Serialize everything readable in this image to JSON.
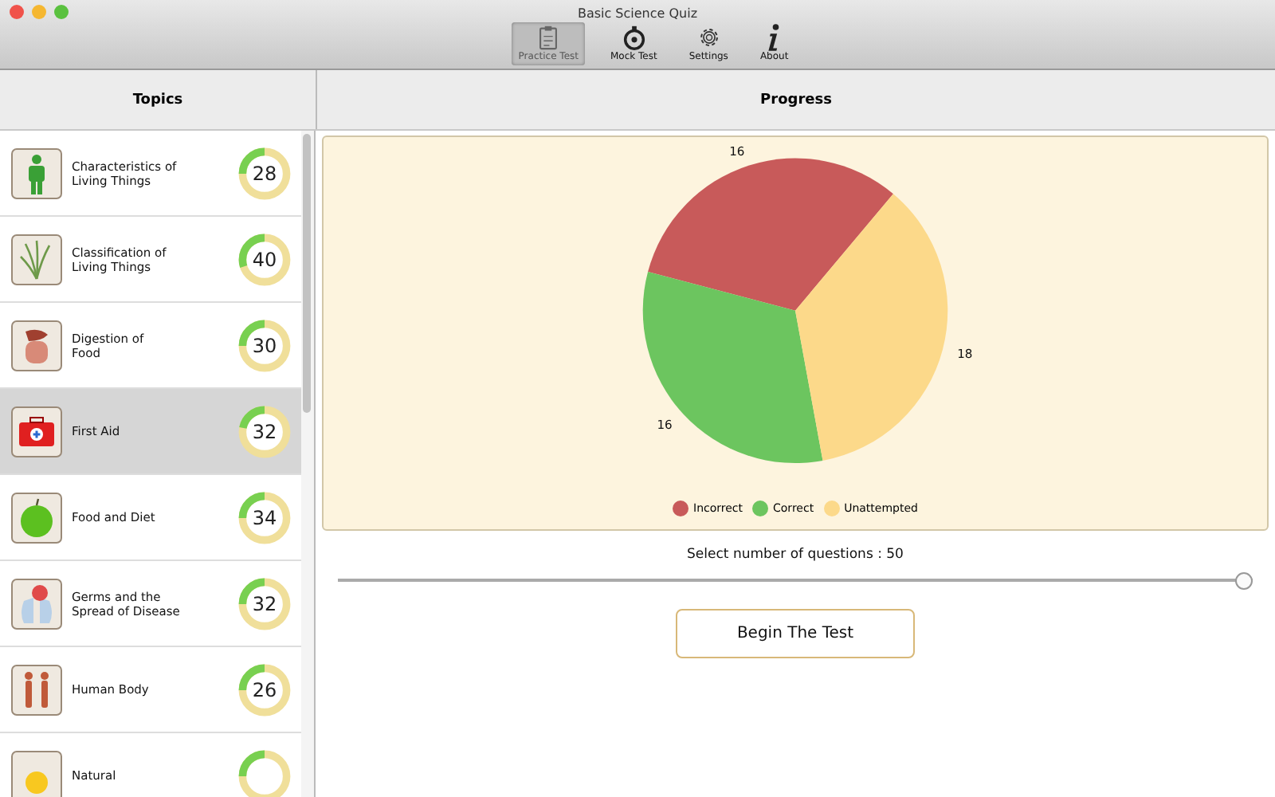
{
  "window": {
    "title": "Basic Science Quiz"
  },
  "toolbar": [
    {
      "label": "Practice Test",
      "kind": "clipboard",
      "selected": true
    },
    {
      "label": "Mock Test",
      "kind": "stopwatch",
      "selected": false
    },
    {
      "label": "Settings",
      "kind": "gear",
      "selected": false
    },
    {
      "label": "About",
      "kind": "info",
      "selected": false
    }
  ],
  "sidebar": {
    "header": "Topics",
    "items": [
      {
        "label": "Characteristics of\nLiving Things",
        "kind": "person",
        "score": "28",
        "level": 0.25,
        "selected": false
      },
      {
        "label": "Classification of\nLiving Things",
        "kind": "grass",
        "score": "40",
        "level": 0.3,
        "selected": false
      },
      {
        "label": "Digestion of\nFood",
        "kind": "stomach",
        "score": "30",
        "level": 0.25,
        "selected": false
      },
      {
        "label": "First Aid",
        "kind": "firstaid",
        "score": "32",
        "level": 0.22,
        "selected": true
      },
      {
        "label": "Food and Diet",
        "kind": "apple",
        "score": "34",
        "level": 0.25,
        "selected": false
      },
      {
        "label": "Germs and the\nSpread of Disease",
        "kind": "lungs",
        "score": "32",
        "level": 0.25,
        "selected": false
      },
      {
        "label": "Human Body",
        "kind": "bodies",
        "score": "26",
        "level": 0.25,
        "selected": false
      },
      {
        "label": "Natural",
        "kind": "sun",
        "level": 0.25,
        "selected": false
      }
    ]
  },
  "progress": {
    "header": "Progress",
    "chart_data": {
      "type": "pie",
      "categories": [
        "Incorrect",
        "Correct",
        "Unattempted"
      ],
      "values": [
        16,
        16,
        18
      ],
      "data_labels": true,
      "colors": [
        "#c85a5a",
        "#6cc55f",
        "#fcd98a"
      ]
    },
    "slider_label": "Select number of questions : 50",
    "slider": {
      "level": 1
    },
    "button": "Begin The Test"
  }
}
